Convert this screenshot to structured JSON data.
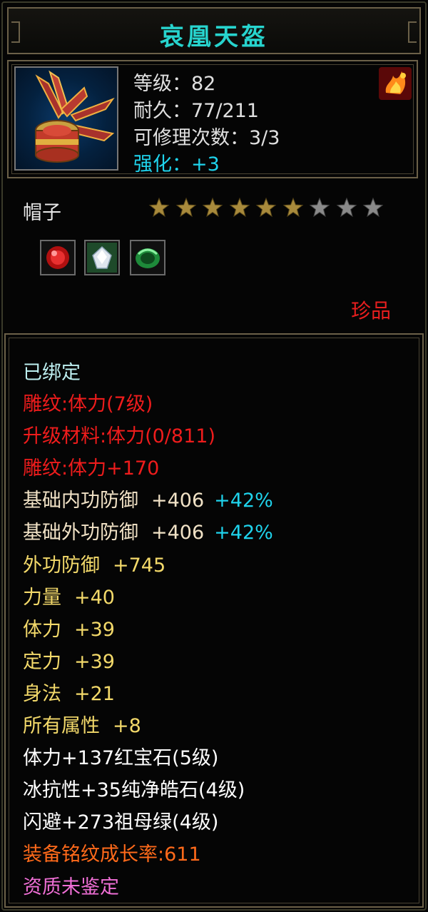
{
  "title": "哀凰天盔",
  "stats": {
    "level": "等级：82",
    "durability": "耐久：77/211",
    "repair": "可修理次数：3/3",
    "enhance": "强化：+3"
  },
  "item_type": "帽子",
  "stars": {
    "filled": 6,
    "total": 9
  },
  "gems": [
    "red-gem-icon",
    "white-gem-icon",
    "green-gem-icon"
  ],
  "rarity": "珍品",
  "attributes": {
    "bound": "已绑定",
    "engrave1": "雕纹:体力(7级)",
    "upgrade_material": "升级材料:体力(0/811)",
    "engrave2": "雕纹:体力+170",
    "inner_def": {
      "label": "基础内功防御",
      "value": "+406",
      "pct": "+42%"
    },
    "outer_def": {
      "label": "基础外功防御",
      "value": "+406",
      "pct": "+42%"
    },
    "ext_def": {
      "label": "外功防御",
      "value": "+745"
    },
    "strength": {
      "label": "力量",
      "value": "+40"
    },
    "stamina": {
      "label": "体力",
      "value": "+39"
    },
    "focus": {
      "label": "定力",
      "value": "+39"
    },
    "agility": {
      "label": "身法",
      "value": "+21"
    },
    "all_attr": {
      "label": "所有属性",
      "value": "+8"
    },
    "gem1": "体力+137红宝石(5级)",
    "gem2": "冰抗性+35纯净皓石(4级)",
    "gem3": "闪避+273祖母绿(4级)",
    "growth": "装备铭纹成长率:611",
    "quality": "资质未鉴定"
  },
  "colors": {
    "title": "#27d4ce",
    "enhance": "#1fd3ec",
    "rarity": "#e81e1e",
    "engrave": "#ee1c1c",
    "base_def": "#f1e2c6",
    "bonus": "#f3d96a",
    "growth": "#ff6a1a",
    "quality": "#f06fd6"
  }
}
